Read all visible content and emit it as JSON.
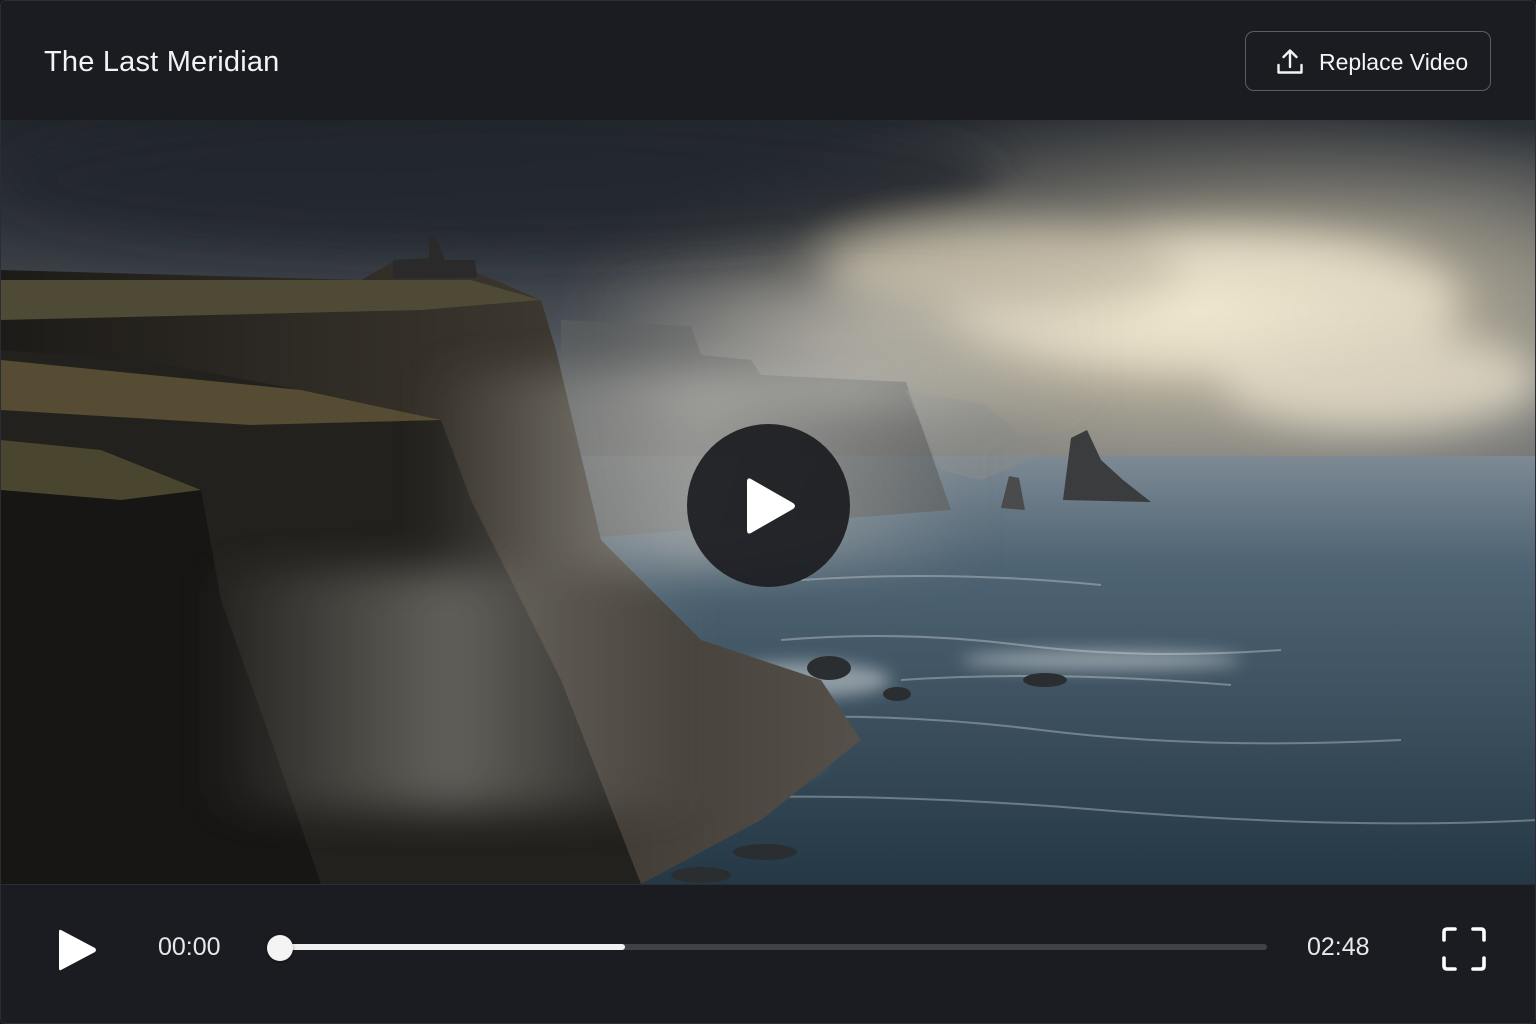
{
  "header": {
    "title": "The Last Meridian",
    "replace_button_label": "Replace Video",
    "replace_button_icon": "upload-icon"
  },
  "video": {
    "state": "paused",
    "center_button_icon": "play-icon"
  },
  "controls": {
    "play_icon": "play-icon",
    "current_time": "00:00",
    "total_time": "02:48",
    "buffered_fraction": 0.35,
    "played_fraction": 0.0,
    "fullscreen_icon": "fullscreen-icon"
  },
  "colors": {
    "background": "#1a1c21",
    "text": "#f2f3f5",
    "track": "#3e4148",
    "progress_fill": "#f1f1f1"
  }
}
